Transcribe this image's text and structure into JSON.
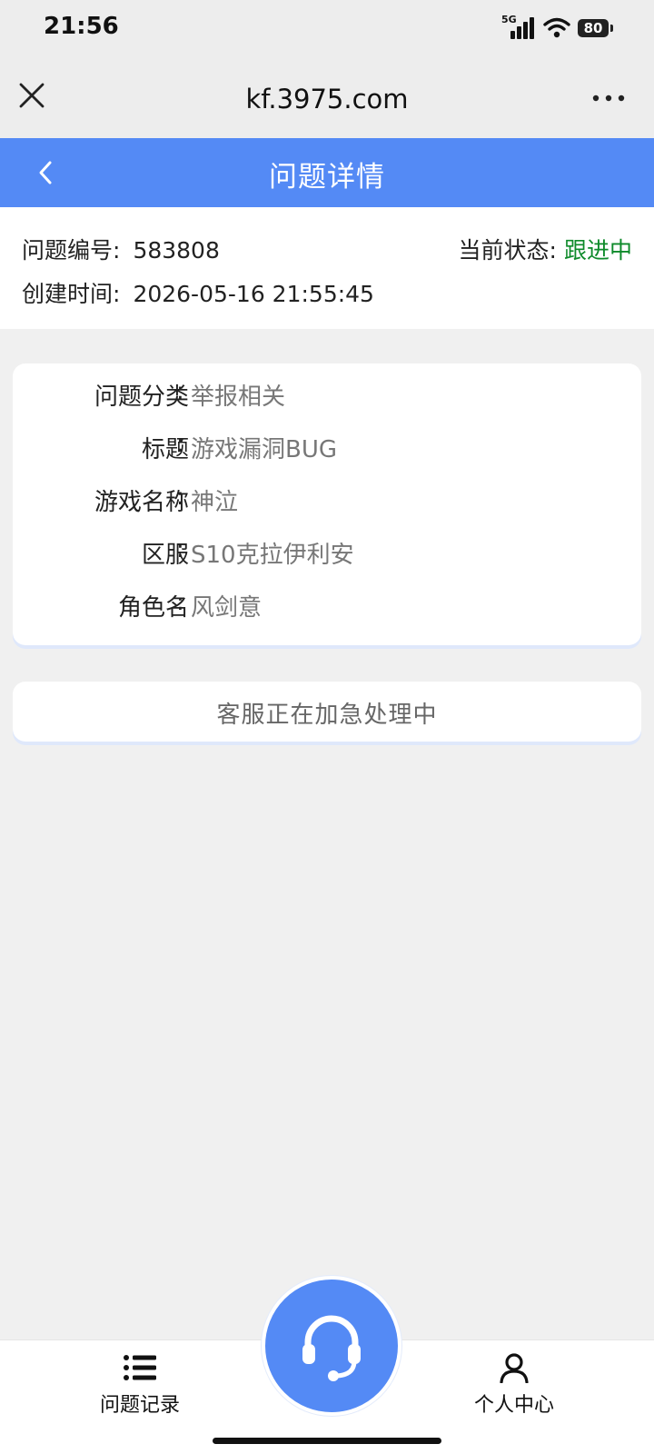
{
  "status_bar": {
    "time": "21:56",
    "network": "5G",
    "battery": "80"
  },
  "browser": {
    "url": "kf.3975.com",
    "close_icon": "close-icon",
    "more_icon": "more-horizontal-icon"
  },
  "header": {
    "title": "问题详情",
    "back_icon": "chevron-left-icon",
    "background": "#548af5"
  },
  "ticket": {
    "number_label": "问题编号:",
    "number": "583808",
    "created_label": "创建时间:",
    "created": "2026-05-16 21:55:45",
    "status_label": "当前状态:",
    "status": "跟进中",
    "status_color": "#0e8a2a"
  },
  "details": [
    {
      "label": "问题分类",
      "value": "举报相关"
    },
    {
      "label": "标题",
      "value": "游戏漏洞BUG"
    },
    {
      "label": "游戏名称",
      "value": "神泣"
    },
    {
      "label": "区服",
      "value": "S10克拉伊利安"
    },
    {
      "label": "角色名",
      "value": "风剑意"
    }
  ],
  "process_message": "客服正在加急处理中",
  "tabbar": {
    "records_label": "问题记录",
    "records_icon": "list-icon",
    "support_icon": "headset-icon",
    "profile_label": "个人中心",
    "profile_icon": "user-icon"
  }
}
